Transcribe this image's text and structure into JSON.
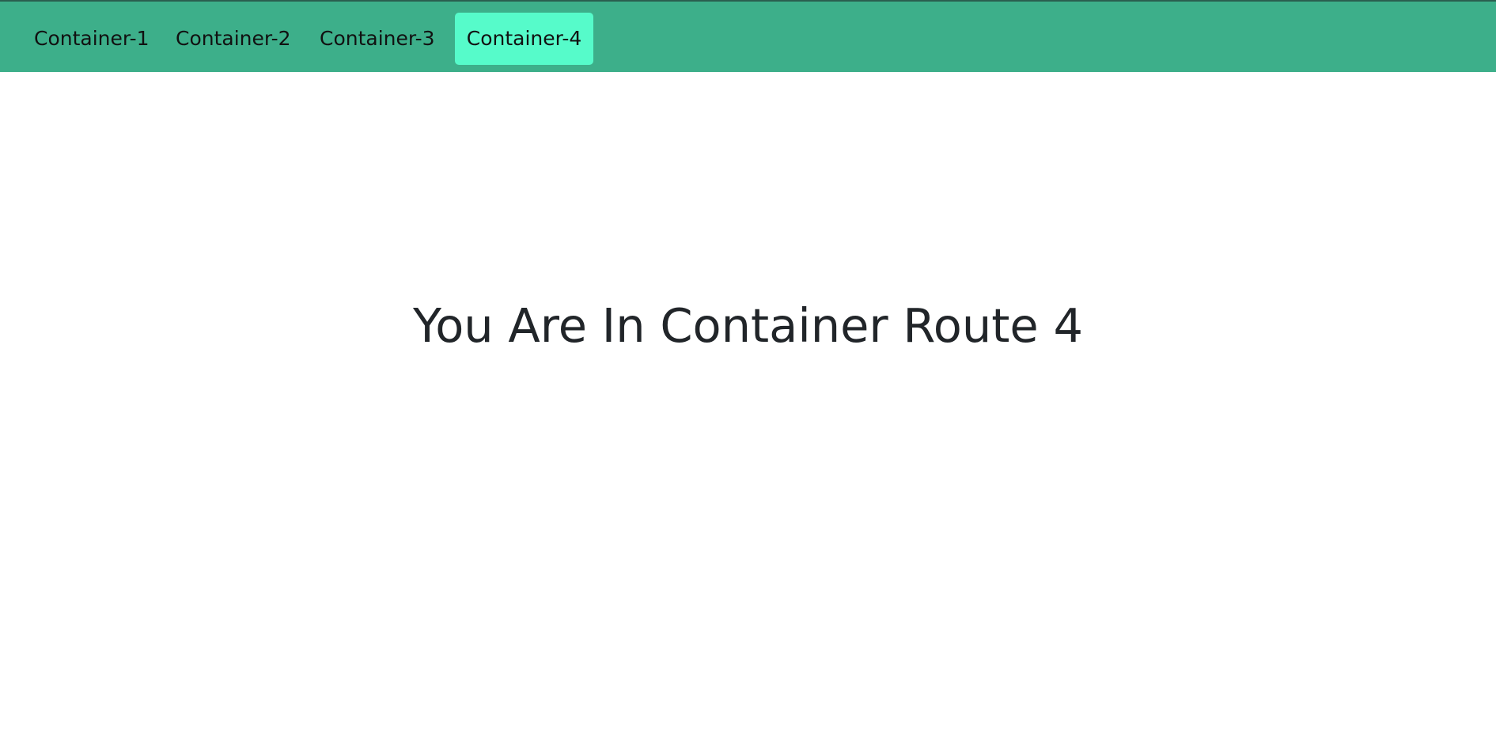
{
  "nav": {
    "items": [
      {
        "label": "Container-1",
        "active": false
      },
      {
        "label": "Container-2",
        "active": false
      },
      {
        "label": "Container-3",
        "active": false
      },
      {
        "label": "Container-4",
        "active": true
      }
    ]
  },
  "main": {
    "heading": "You Are In Container Route 4"
  },
  "colors": {
    "navbar_bg": "#3daf8a",
    "active_item_bg": "#56fbca",
    "heading_text": "#212529"
  }
}
